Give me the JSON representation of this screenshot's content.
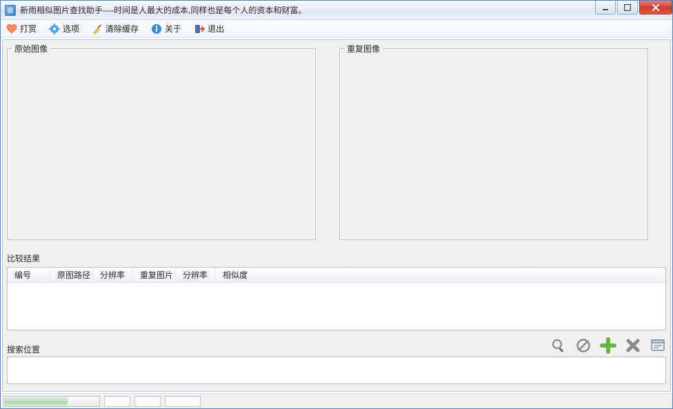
{
  "window": {
    "title": "新雨相似图片查找助手----时间是人最大的成本,同样也是每个人的资本和财富。"
  },
  "toolbar": {
    "donate": "打赏",
    "options": "选项",
    "clear_cache": "清除缓存",
    "about": "关于",
    "exit": "退出"
  },
  "panes": {
    "original": "原始图像",
    "duplicate": "重复图像"
  },
  "results": {
    "label": "比较结果",
    "columns": [
      "编号",
      "原图路径",
      "分辨率",
      "重复图片",
      "分辨率",
      "相似度"
    ],
    "rows": []
  },
  "search": {
    "label": "搜索位置",
    "value": ""
  },
  "status": {
    "progress_percent": 66
  }
}
